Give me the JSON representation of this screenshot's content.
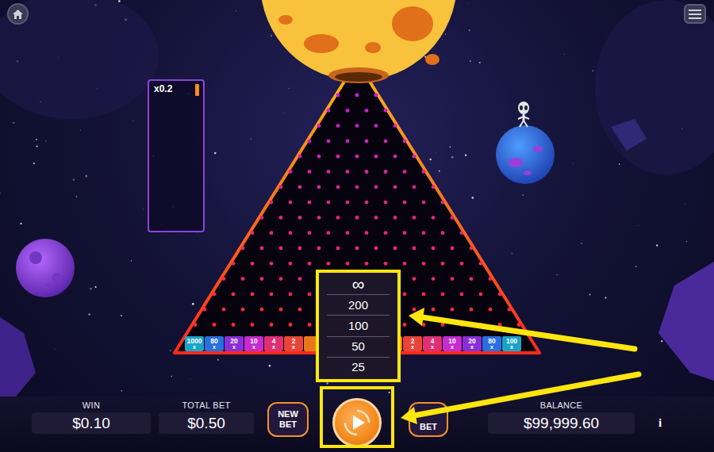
{
  "history": [
    {
      "text": "x0.2"
    }
  ],
  "slots_left": [
    {
      "value": "1000",
      "suffix": "x",
      "color": "#1aa3c9"
    },
    {
      "value": "80",
      "suffix": "x",
      "color": "#2a6fe0"
    },
    {
      "value": "20",
      "suffix": "x",
      "color": "#8a2fd8"
    },
    {
      "value": "10",
      "suffix": "x",
      "color": "#c52bcf"
    },
    {
      "value": "4",
      "suffix": "x",
      "color": "#e02f72"
    },
    {
      "value": "2",
      "suffix": "x",
      "color": "#e8443a"
    }
  ],
  "slots_right": [
    {
      "value": "2",
      "suffix": "x",
      "color": "#e8443a"
    },
    {
      "value": "4",
      "suffix": "x",
      "color": "#e02f72"
    },
    {
      "value": "10",
      "suffix": "x",
      "color": "#c52bcf"
    },
    {
      "value": "20",
      "suffix": "x",
      "color": "#8a2fd8"
    },
    {
      "value": "80",
      "suffix": "x",
      "color": "#2a6fe0"
    },
    {
      "value": "100",
      "suffix": "x",
      "color": "#1aa3c9"
    }
  ],
  "autoplay_menu": {
    "open": true,
    "options": [
      {
        "label": "∞",
        "selected": false
      },
      {
        "label": "200",
        "selected": false
      },
      {
        "label": "100",
        "selected": false
      },
      {
        "label": "50",
        "selected": false
      },
      {
        "label": "25",
        "selected": false
      }
    ]
  },
  "status": {
    "win": {
      "label": "WIN",
      "value": "$0.10"
    },
    "total_bet": {
      "label": "TOTAL BET",
      "value": "$0.50"
    },
    "balance": {
      "label": "BALANCE",
      "value": "$99,999.60"
    }
  },
  "buttons": {
    "new_bet": "NEW BET",
    "bet": "BET",
    "info": "i"
  }
}
